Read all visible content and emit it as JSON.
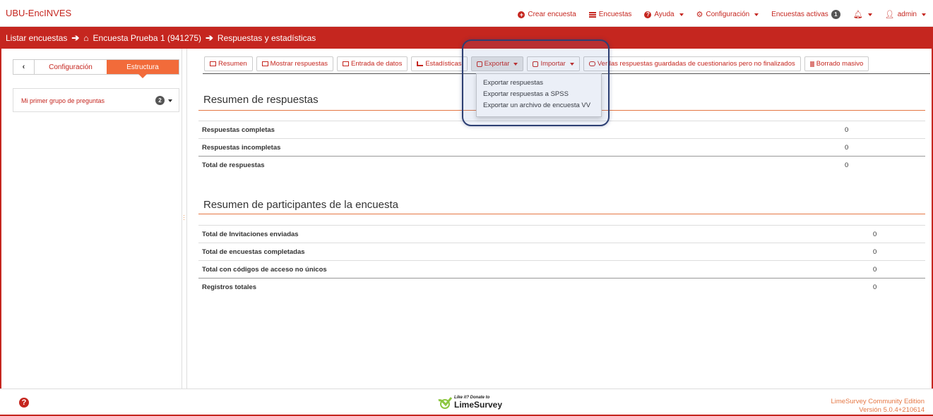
{
  "app": {
    "brand": "UBU-EncINVES"
  },
  "topnav": {
    "create": "Crear encuesta",
    "surveys": "Encuestas",
    "help": "Ayuda",
    "config": "Configuración",
    "active": "Encuestas activas",
    "active_count": "1",
    "user": "admin"
  },
  "breadcrumb": {
    "item1": "Listar encuestas",
    "item2": "Encuesta Prueba 1 (941275)",
    "item3": "Respuestas y estadísticas"
  },
  "sidebar": {
    "tab_config": "Configuración",
    "tab_structure": "Estructura",
    "group_label": "Mi primer grupo de preguntas",
    "group_count": "2"
  },
  "toolbar": {
    "summary": "Resumen",
    "show_responses": "Mostrar respuestas",
    "data_entry": "Entrada de datos",
    "statistics": "Estadísticas",
    "export": "Exportar",
    "import": "Importar",
    "saved": "Ver las respuestas guardadas de cuestionarios pero no finalizados",
    "mass_delete": "Borrado masivo"
  },
  "export_menu": {
    "items": [
      "Exportar respuestas",
      "Exportar respuestas a SPSS",
      "Exportar un archivo de encuesta VV"
    ]
  },
  "response_summary": {
    "title": "Resumen de respuestas",
    "rows": [
      {
        "label": "Respuestas completas",
        "value": "0"
      },
      {
        "label": "Respuestas incompletas",
        "value": "0"
      },
      {
        "label": "Total de respuestas",
        "value": "0"
      }
    ]
  },
  "participant_summary": {
    "title": "Resumen de participantes de la encuesta",
    "rows": [
      {
        "label": "Total de Invitaciones enviadas",
        "value": "0"
      },
      {
        "label": "Total de encuestas completadas",
        "value": "0"
      },
      {
        "label": "Total con códigos de acceso no únicos",
        "value": "0"
      },
      {
        "label": "Registros totales",
        "value": "0"
      }
    ]
  },
  "footer": {
    "donate_small": "Like it? Donate to",
    "donate_big": "LimeSurvey",
    "edition": "LimeSurvey Community Edition",
    "version": "Versión 5.0.4+210614"
  }
}
